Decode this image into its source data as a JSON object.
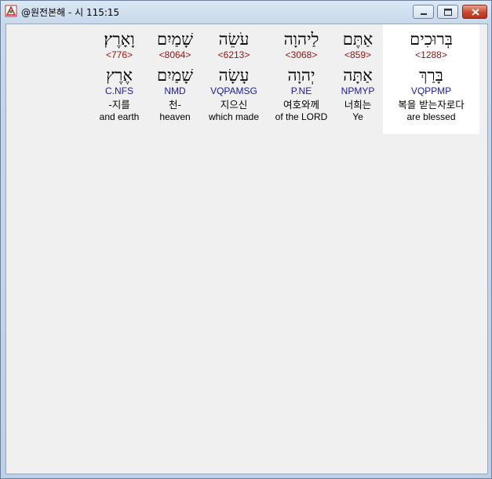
{
  "window": {
    "title": "@원전본해 - 시 115:15"
  },
  "words": [
    {
      "hebrew": "בְּרוּכִים",
      "strong": "<1288>",
      "lemma": "בָּרַךְ",
      "morph": "VQPPMP",
      "korean": "복을 받는자로다",
      "english": "are blessed",
      "highlighted": true
    },
    {
      "hebrew": "אַתֶּם",
      "strong": "<859>",
      "lemma": "אַתָּה",
      "morph": "NPMYP",
      "korean": "너희는",
      "english": "Ye",
      "highlighted": false
    },
    {
      "hebrew": "לַיהוָה",
      "strong": "<3068>",
      "lemma": "יְהוָה",
      "morph": "P.NE",
      "korean": "여호와께",
      "english": "of the LORD",
      "highlighted": false
    },
    {
      "hebrew": "עֹשֵׂה",
      "strong": "<6213>",
      "lemma": "עָשָׂה",
      "morph": "VQPAMSG",
      "korean": "지으신",
      "english": "which made",
      "highlighted": false
    },
    {
      "hebrew": "שָׁמַיִם",
      "strong": "<8064>",
      "lemma": "שָׁמַיִם",
      "morph": "NMD",
      "korean": "천-",
      "english": "heaven",
      "highlighted": false
    },
    {
      "hebrew": "וָאָרֶץ׃",
      "strong": "<776>",
      "lemma": "אֶרֶץ",
      "morph": "C.NFS",
      "korean": "-지를",
      "english": "and earth",
      "highlighted": false
    }
  ]
}
